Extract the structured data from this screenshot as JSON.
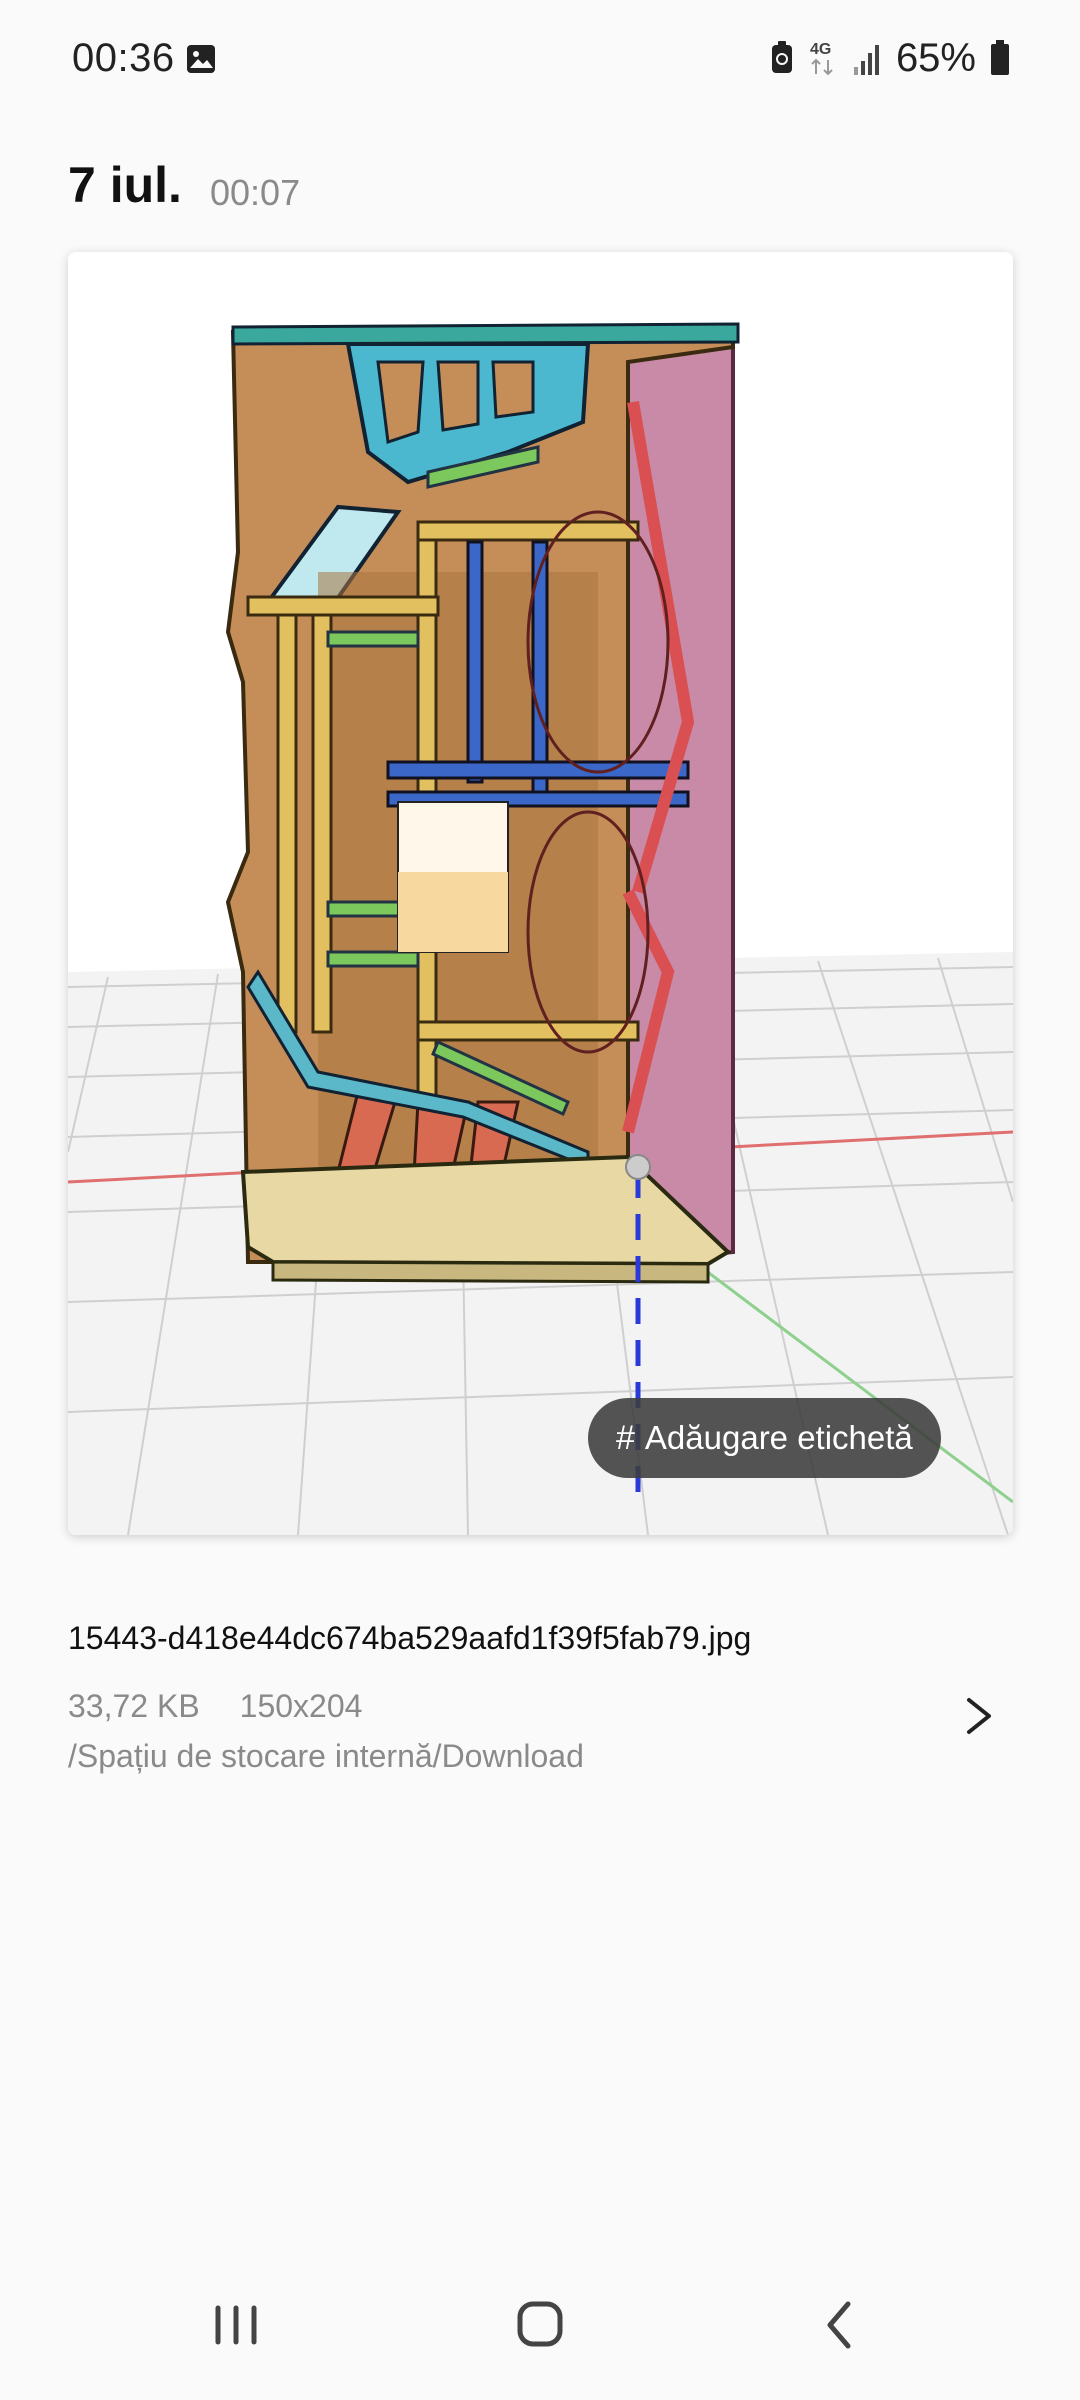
{
  "status_bar": {
    "time": "00:36",
    "network": "4G",
    "battery": "65%"
  },
  "header": {
    "date": "7 iul.",
    "time": "00:07"
  },
  "image": {
    "tag_label": "Adăugare etichetă",
    "tag_symbol": "#"
  },
  "details": {
    "file_name": "15443-d418e44dc674ba529aafd1f39f5fab79.jpg",
    "size": "33,72 KB",
    "resolution": "150x204",
    "path": "/Spațiu de stocare internă/Download"
  },
  "icons": {
    "status_gallery": "image-icon",
    "status_recycle": "battery-saver-icon",
    "status_signal": "signal-icon",
    "status_battery": "battery-icon",
    "details_arrow": "chevron-right-icon",
    "nav_recent": "recent-apps-icon",
    "nav_home": "home-icon",
    "nav_back": "back-icon"
  },
  "colors": {
    "background": "#fafafa",
    "secondary_text": "#8a8a8a",
    "chip_bg": "#3c3c3c"
  }
}
